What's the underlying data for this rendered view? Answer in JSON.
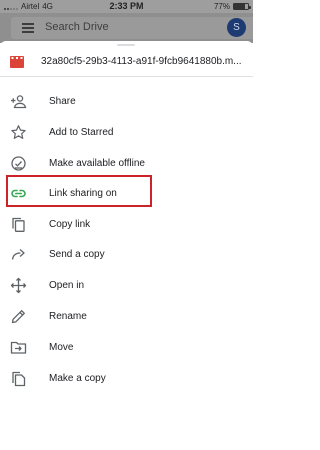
{
  "status_bar": {
    "carrier": "Airtel",
    "network": "4G",
    "time": "2:33 PM",
    "battery": "77%",
    "battery_level": 0.77
  },
  "header": {
    "search_placeholder": "Search Drive",
    "avatar_initial": "S"
  },
  "file": {
    "name": "32a80cf5-29b3-4113-a91f-9fcb9641880b.m...",
    "icon": "video-file-icon",
    "icon_color": "#db4437"
  },
  "menu": {
    "items": [
      {
        "label": "Share",
        "icon": "add-person-icon"
      },
      {
        "label": "Add to Starred",
        "icon": "star-outline-icon"
      },
      {
        "label": "Make available offline",
        "icon": "offline-check-icon"
      },
      {
        "label": "Link sharing on",
        "icon": "link-icon"
      },
      {
        "label": "Copy link",
        "icon": "copy-icon"
      },
      {
        "label": "Send a copy",
        "icon": "send-arrow-icon"
      },
      {
        "label": "Open in",
        "icon": "move-arrows-icon"
      },
      {
        "label": "Rename",
        "icon": "pencil-icon"
      },
      {
        "label": "Move",
        "icon": "folder-move-icon"
      },
      {
        "label": "Make a copy",
        "icon": "file-copy-icon"
      }
    ]
  },
  "colors": {
    "link_icon": "#34a853",
    "highlight_border": "#cc2229",
    "icon_gray": "#5f6368"
  }
}
